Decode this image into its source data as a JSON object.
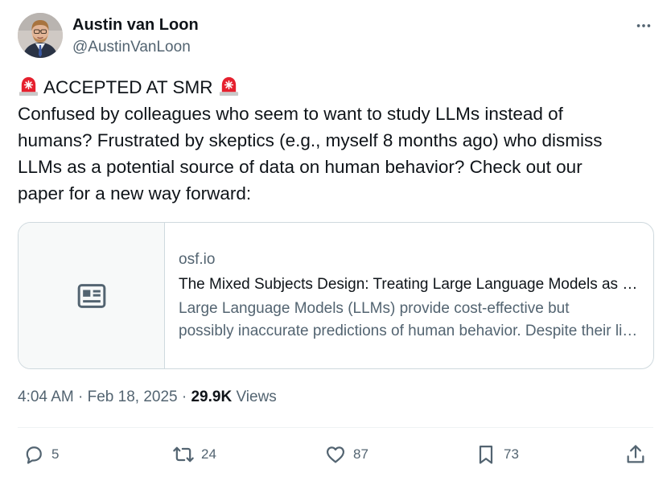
{
  "author": {
    "display_name": "Austin van Loon",
    "handle": "@AustinVanLoon"
  },
  "tweet": {
    "headline": "ACCEPTED AT SMR",
    "lines": [
      "Confused by colleagues who seem to want to study LLMs instead of",
      "humans? Frustrated by skeptics (e.g., myself 8 months ago) who dismiss",
      "LLMs as a potential source of data on human behavior? Check out our",
      "paper for a new way forward:"
    ]
  },
  "card": {
    "domain": "osf.io",
    "title": "The Mixed Subjects Design: Treating Large Language Models as (Potentially) Informative Observations",
    "desc_line1": "Large Language Models (LLMs) provide cost-effective but",
    "desc_line2": "possibly inaccurate predictions of human behavior. Despite their limitations"
  },
  "meta": {
    "time": "4:04 AM",
    "date": "Feb 18, 2025",
    "sep": "·",
    "views_count": "29.9K",
    "views_label": "Views"
  },
  "actions": {
    "replies": "5",
    "reposts": "24",
    "likes": "87",
    "bookmarks": "73"
  },
  "icons": {
    "siren": "siren-emoji-icon",
    "more": "more-horizontal-icon",
    "card": "newspaper-icon",
    "reply": "reply-icon",
    "repost": "repost-icon",
    "like": "heart-icon",
    "bookmark": "bookmark-icon",
    "share": "share-icon"
  },
  "colors": {
    "text_primary": "#0f1419",
    "text_secondary": "#536471",
    "border": "#cfd9de",
    "siren_red": "#e5202e"
  }
}
